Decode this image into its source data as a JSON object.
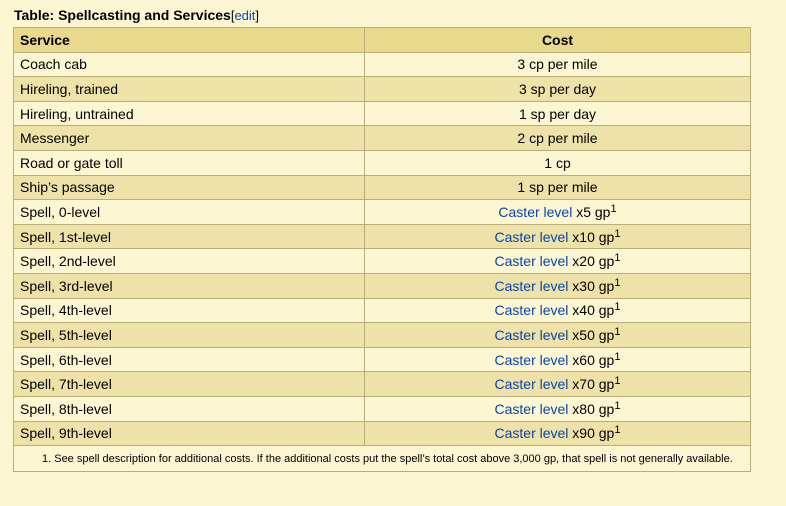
{
  "caption": {
    "title": "Table: Spellcasting and Services",
    "edit_open": "[",
    "edit_link": "edit",
    "edit_close": "]"
  },
  "table": {
    "headers": {
      "service": "Service",
      "cost": "Cost"
    },
    "rows": [
      {
        "service": "Coach cab",
        "cost": "3 cp per mile"
      },
      {
        "service": "Hireling, trained",
        "cost": "3 sp per day"
      },
      {
        "service": "Hireling, untrained",
        "cost": "1 sp per day"
      },
      {
        "service": "Messenger",
        "cost": "2 cp per mile"
      },
      {
        "service": "Road or gate toll",
        "cost": "1 cp"
      },
      {
        "service": "Ship’s passage",
        "cost": "1 sp per mile"
      },
      {
        "service": "Spell, 0-level",
        "cost_link": "Caster level",
        "cost": " x5 gp",
        "sup": "1"
      },
      {
        "service": "Spell, 1st-level",
        "cost_link": "Caster level",
        "cost": " x10 gp",
        "sup": "1"
      },
      {
        "service": "Spell, 2nd-level",
        "cost_link": "Caster level",
        "cost": " x20 gp",
        "sup": "1"
      },
      {
        "service": "Spell, 3rd-level",
        "cost_link": "Caster level",
        "cost": " x30 gp",
        "sup": "1"
      },
      {
        "service": "Spell, 4th-level",
        "cost_link": "Caster level",
        "cost": " x40 gp",
        "sup": "1"
      },
      {
        "service": "Spell, 5th-level",
        "cost_link": "Caster level",
        "cost": " x50 gp",
        "sup": "1"
      },
      {
        "service": "Spell, 6th-level",
        "cost_link": "Caster level",
        "cost": " x60 gp",
        "sup": "1"
      },
      {
        "service": "Spell, 7th-level",
        "cost_link": "Caster level",
        "cost": " x70 gp",
        "sup": "1"
      },
      {
        "service": "Spell, 8th-level",
        "cost_link": "Caster level",
        "cost": " x80 gp",
        "sup": "1"
      },
      {
        "service": "Spell, 9th-level",
        "cost_link": "Caster level",
        "cost": " x90 gp",
        "sup": "1"
      }
    ],
    "footnote": "1. See spell description for additional costs. If the additional costs put the spell’s total cost above 3,000 gp, that spell is not generally available."
  }
}
